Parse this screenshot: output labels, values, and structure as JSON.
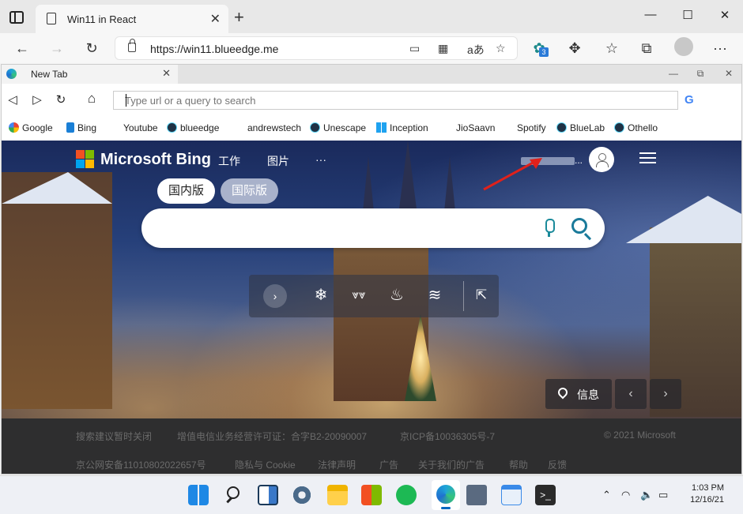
{
  "outer_browser": {
    "tab_title": "Win11 in React",
    "tab_close": "✕",
    "new_tab": "+",
    "url": "https://win11.blueedge.me",
    "extension_badge": "3",
    "more": "···"
  },
  "inner_browser": {
    "tab_label": "New Tab",
    "tab_close": "✕",
    "url_placeholder": "Type url or a query to search",
    "bookmarks": [
      "Google",
      "Bing",
      "Youtube",
      "blueedge",
      "andrewstech",
      "Unescape",
      "Inception",
      "JioSaavn",
      "Spotify",
      "BlueLab",
      "Othello"
    ]
  },
  "bing": {
    "logo_text": "Microsoft Bing",
    "nav": [
      "工作",
      "图片",
      "···"
    ],
    "user_suffix": "...",
    "region_tabs": [
      "国内版",
      "国际版"
    ],
    "info_label": "信息",
    "footer_row1": [
      "搜索建议暂时关闭",
      "增值电信业务经营许可证：合字B2-20090007",
      "京ICP备10036305号-7",
      "© 2021 Microsoft"
    ],
    "footer_row2": [
      "京公网安备11010802022657号",
      "隐私与 Cookie",
      "法律声明",
      "广告",
      "关于我们的广告",
      "帮助",
      "反馈"
    ]
  },
  "taskbar": {
    "time": "1:03 PM",
    "date": "12/16/21"
  },
  "colors": {
    "accent": "#0067c0",
    "annotation_arrow": "#e0211b"
  }
}
